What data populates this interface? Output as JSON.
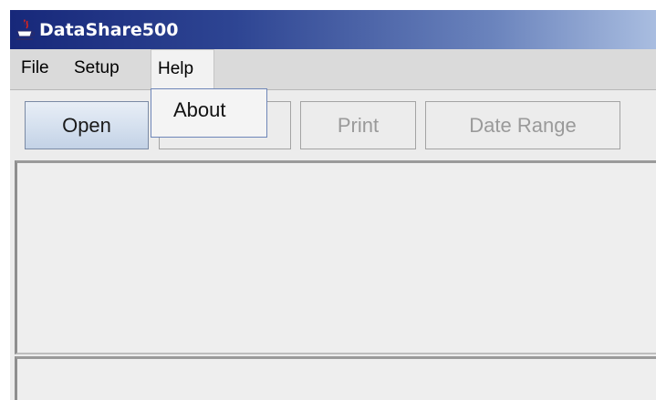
{
  "window": {
    "title": "DataShare500",
    "icon": "java-cup-icon"
  },
  "menubar": {
    "items": [
      {
        "label": "File"
      },
      {
        "label": "Setup"
      },
      {
        "label": "Help"
      }
    ],
    "open_menu": "Help"
  },
  "help_menu": {
    "items": [
      {
        "label": "About"
      }
    ]
  },
  "toolbar": {
    "buttons": [
      {
        "label": "Open",
        "enabled": true
      },
      {
        "label": "",
        "enabled": false
      },
      {
        "label": "Print",
        "enabled": false
      },
      {
        "label": "Date Range",
        "enabled": false
      }
    ]
  },
  "colors": {
    "titlebar_start": "#17287a",
    "titlebar_end": "#a9bde0",
    "menu_border": "#6e86b8",
    "disabled_text": "#9a9a9a"
  }
}
